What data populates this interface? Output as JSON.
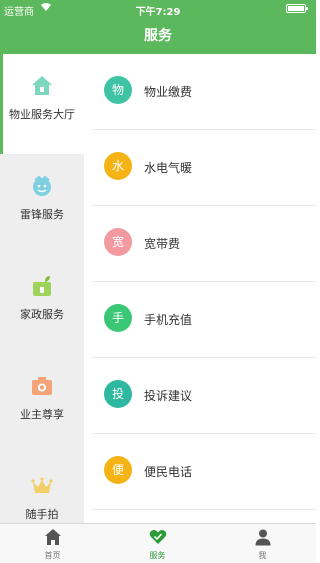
{
  "status_bar": {
    "carrier": "运营商",
    "time": "下午7:29"
  },
  "nav": {
    "title": "服务"
  },
  "sidebar": {
    "items": [
      {
        "label": "物业服务大厅",
        "icon": "house-icon",
        "color": "#7fd6c0"
      },
      {
        "label": "雷锋服务",
        "icon": "smiley-face-icon",
        "color": "#7ecfe0"
      },
      {
        "label": "家政服务",
        "icon": "house-plant-icon",
        "color": "#9fd45b"
      },
      {
        "label": "业主尊享",
        "icon": "camera-icon",
        "color": "#f5a47a"
      },
      {
        "label": "随手拍",
        "icon": "crown-icon",
        "color": "#f3cf6a"
      }
    ]
  },
  "services": [
    {
      "badge": "物",
      "label": "物业缴费",
      "color": "#3fc3a5"
    },
    {
      "badge": "水",
      "label": "水电气暖",
      "color": "#f5b316"
    },
    {
      "badge": "宽",
      "label": "宽带费",
      "color": "#f39aa0"
    },
    {
      "badge": "手",
      "label": "手机充值",
      "color": "#3bc876"
    },
    {
      "badge": "投",
      "label": "投诉建议",
      "color": "#2fb8a0"
    },
    {
      "badge": "便",
      "label": "便民电话",
      "color": "#f5b316"
    }
  ],
  "tabbar": {
    "tabs": [
      {
        "label": "首页",
        "icon": "home-icon"
      },
      {
        "label": "服务",
        "icon": "heart-icon"
      },
      {
        "label": "我",
        "icon": "user-icon"
      }
    ]
  }
}
